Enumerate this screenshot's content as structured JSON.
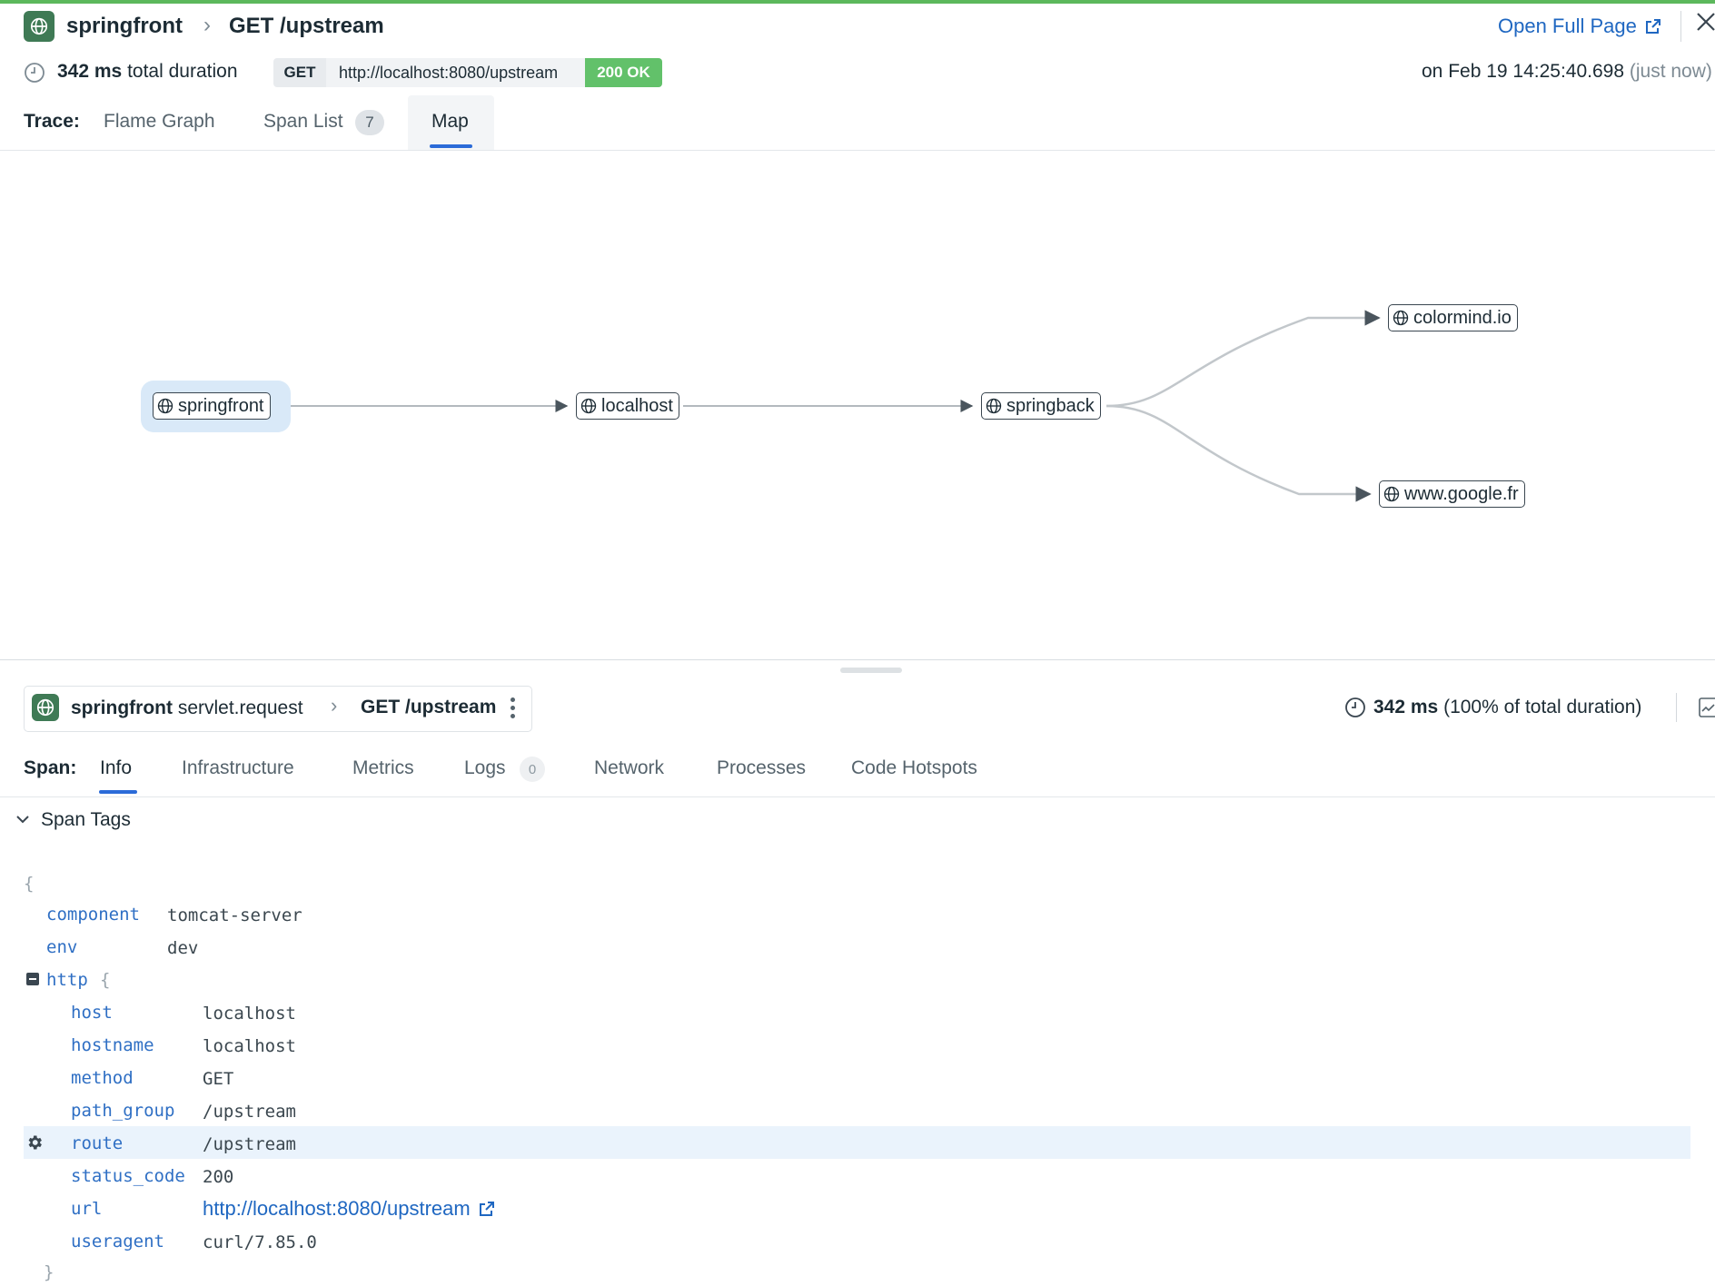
{
  "header": {
    "service": "springfront",
    "resource": "GET /upstream",
    "open_full_page": "Open Full Page",
    "duration_value": "342 ms",
    "duration_suffix": "total duration",
    "method": "GET",
    "url": "http://localhost:8080/upstream",
    "status": "200 OK",
    "timestamp": "on Feb 19 14:25:40.698",
    "relative_time": "(just now)"
  },
  "trace_tabs": {
    "label": "Trace:",
    "items": [
      {
        "label": "Flame Graph"
      },
      {
        "label": "Span List",
        "count": "7"
      },
      {
        "label": "Map",
        "active": true
      }
    ]
  },
  "map": {
    "nodes": [
      {
        "label": "springfront",
        "selected": true
      },
      {
        "label": "localhost"
      },
      {
        "label": "springback"
      },
      {
        "label": "colormind.io"
      },
      {
        "label": "www.google.fr"
      }
    ],
    "edges": [
      [
        "springfront",
        "localhost"
      ],
      [
        "localhost",
        "springback"
      ],
      [
        "springback",
        "colormind.io"
      ],
      [
        "springback",
        "www.google.fr"
      ]
    ]
  },
  "span": {
    "service": "springfront",
    "operation": "servlet.request",
    "resource": "GET /upstream",
    "duration_value": "342 ms",
    "duration_suffix": "(100% of total duration)"
  },
  "span_tabs": {
    "label": "Span:",
    "items": [
      {
        "label": "Info",
        "active": true
      },
      {
        "label": "Infrastructure"
      },
      {
        "label": "Metrics"
      },
      {
        "label": "Logs",
        "count": "0"
      },
      {
        "label": "Network"
      },
      {
        "label": "Processes"
      },
      {
        "label": "Code Hotspots"
      }
    ]
  },
  "span_tags": {
    "section_title": "Span Tags",
    "open_brace": "{",
    "close_brace": "}",
    "top_level": [
      {
        "key": "component",
        "value": "tomcat-server"
      },
      {
        "key": "env",
        "value": "dev"
      }
    ],
    "http_key": "http",
    "http_open": "{",
    "http": [
      {
        "key": "host",
        "value": "localhost"
      },
      {
        "key": "hostname",
        "value": "localhost"
      },
      {
        "key": "method",
        "value": "GET"
      },
      {
        "key": "path_group",
        "value": "/upstream"
      },
      {
        "key": "route",
        "value": "/upstream",
        "highlighted": true
      },
      {
        "key": "status_code",
        "value": "200"
      },
      {
        "key": "url",
        "value": "http://localhost:8080/upstream",
        "link": true
      },
      {
        "key": "useragent",
        "value": "curl/7.85.0"
      }
    ]
  },
  "colors": {
    "accent": "#2b6bd8",
    "status_ok": "#62c16a",
    "service_icon": "#3f7a55",
    "json_key": "#2f6fc4"
  }
}
